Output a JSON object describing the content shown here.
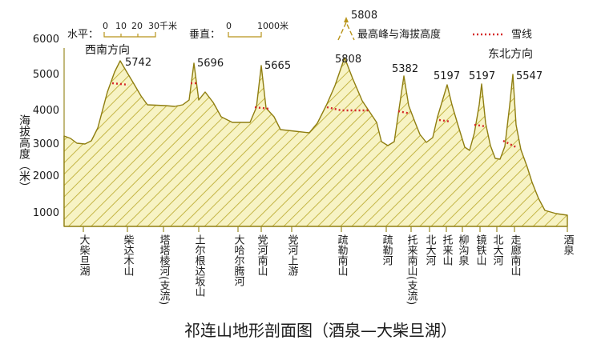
{
  "title": "祁连山地形剖面图（酒泉—大柴旦湖）",
  "axis": {
    "ylabel": "海拔高度（米）",
    "ticks": [
      1000,
      2000,
      3000,
      4000,
      5000,
      6000
    ]
  },
  "legend": {
    "horizontal_label": "水平：",
    "horizontal_ticks": [
      "0",
      "10",
      "20",
      "30千米"
    ],
    "vertical_label": "垂直：",
    "vertical_ticks": [
      "0",
      "1000米"
    ],
    "peak_label": "最高峰与海拔高度",
    "peak_value": "5808",
    "snowline_label": "雪线"
  },
  "directions": {
    "southwest": "西南方向",
    "northeast": "东北方向"
  },
  "peaks": [
    {
      "elevation": "5742"
    },
    {
      "elevation": "5696"
    },
    {
      "elevation": "5665"
    },
    {
      "elevation": "5808"
    },
    {
      "elevation": "5382"
    },
    {
      "elevation": "5197"
    },
    {
      "elevation": "5197"
    },
    {
      "elevation": "5547"
    }
  ],
  "places": [
    "大柴旦湖",
    "柴达木山",
    "塔塔棱河(支流)",
    "土尔根达坂山",
    "大哈尔腾河",
    "党河南山",
    "党河上游",
    "疏勒南山",
    "疏勒河",
    "托来南山(支流)",
    "北大河",
    "托来山",
    "柳沟泉",
    "镜铁山",
    "北大河",
    "走廊南山",
    "酒泉"
  ],
  "colors": {
    "fill": "#f7f3c4",
    "hatch": "#c4b546",
    "outline": "#8f7e10",
    "snowline": "#d62828",
    "tick": "#9a8a24"
  }
}
